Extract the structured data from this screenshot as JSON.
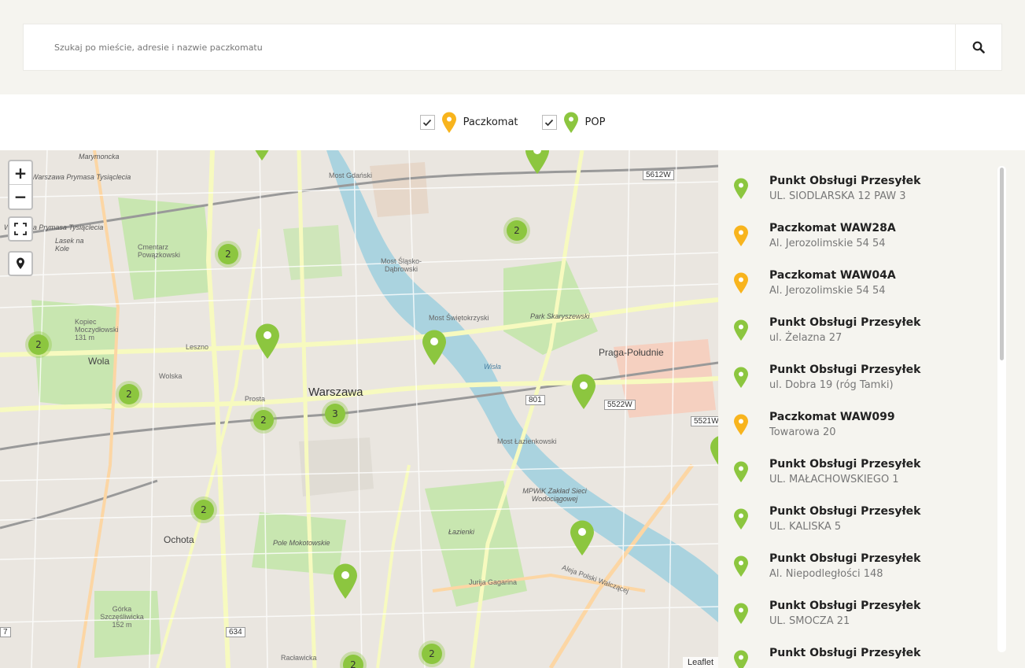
{
  "search": {
    "placeholder": "Szukaj po mieście, adresie i nazwie paczkomatu",
    "button_icon": "search-icon"
  },
  "filters": [
    {
      "label": "Paczkomat",
      "checked": true,
      "color": "#f8b41d"
    },
    {
      "label": "POP",
      "checked": true,
      "color": "#8cc63f"
    }
  ],
  "map": {
    "zoom_in": "+",
    "zoom_out": "−",
    "attribution": "Leaflet",
    "labels": {
      "marymoncka": "Marymoncka",
      "warszawa_prymasa_1": "Warszawa Prymasa Tysiąclecia",
      "warszawa_prymasa_2": "Warszawa Prymasa Tysiąclecia",
      "lasek_na_kole": "Lasek na Kole",
      "cmentarz": "Cmentarz Powązkowski",
      "kopiec": "Kopiec Moczydłowski 131 m",
      "wola": "Wola",
      "warszawa": "Warszawa",
      "ochota": "Ochota",
      "pole_mokotowskie": "Pole Mokotowskie",
      "gorka": "Górka Szczęśliwicka 152 m",
      "most_gdanski": "Most Gdański",
      "most_slasko": "Most Śląsko-Dąbrowski",
      "most_swietokrzyski": "Most Świętokrzyski",
      "most_lazienkowski": "Most Łazienkowski",
      "park_skaryszewski": "Park Skaryszewski",
      "praga_poludnie": "Praga-Południe",
      "wisla": "Wisła",
      "lazienki": "Łazienki",
      "mpwik": "MPWiK Zakład Sieci Wodociągowej",
      "jurija_gagarina": "Jurija Gagarina",
      "aleja_polski": "Aleja Polski Walczącej",
      "road_5612w": "5612W",
      "road_5522w": "5522W",
      "road_5521w": "5521W",
      "road_801": "801",
      "road_634": "634",
      "road_7": "7",
      "prosta": "Prosta",
      "wolska": "Wolska",
      "leszno": "Leszno",
      "raclawicka": "Racławicka"
    },
    "clusters": [
      {
        "count": "2"
      },
      {
        "count": "2"
      },
      {
        "count": "2"
      },
      {
        "count": "2"
      },
      {
        "count": "2"
      },
      {
        "count": "3"
      },
      {
        "count": "2"
      },
      {
        "count": "2"
      },
      {
        "count": "2"
      }
    ]
  },
  "list": [
    {
      "title": "Punkt Obsługi Przesyłek",
      "address": "UL. SIODLARSKA 12 PAW 3",
      "type": "POP"
    },
    {
      "title": "Paczkomat WAW28A",
      "address": "Al. Jerozolimskie 54 54",
      "type": "Paczkomat"
    },
    {
      "title": "Paczkomat WAW04A",
      "address": "Al. Jerozolimskie 54 54",
      "type": "Paczkomat"
    },
    {
      "title": "Punkt Obsługi Przesyłek",
      "address": "ul. Żelazna 27",
      "type": "POP"
    },
    {
      "title": "Punkt Obsługi Przesyłek",
      "address": "ul. Dobra 19 (róg Tamki)",
      "type": "POP"
    },
    {
      "title": "Paczkomat WAW099",
      "address": "Towarowa 20",
      "type": "Paczkomat"
    },
    {
      "title": "Punkt Obsługi Przesyłek",
      "address": "UL. MAŁACHOWSKIEGO 1",
      "type": "POP"
    },
    {
      "title": "Punkt Obsługi Przesyłek",
      "address": "UL. KALISKA 5",
      "type": "POP"
    },
    {
      "title": "Punkt Obsługi Przesyłek",
      "address": "Al. Niepodległości 148",
      "type": "POP"
    },
    {
      "title": "Punkt Obsługi Przesyłek",
      "address": "UL. SMOCZA 21",
      "type": "POP"
    },
    {
      "title": "Punkt Obsługi Przesyłek",
      "address": "",
      "type": "POP"
    }
  ]
}
